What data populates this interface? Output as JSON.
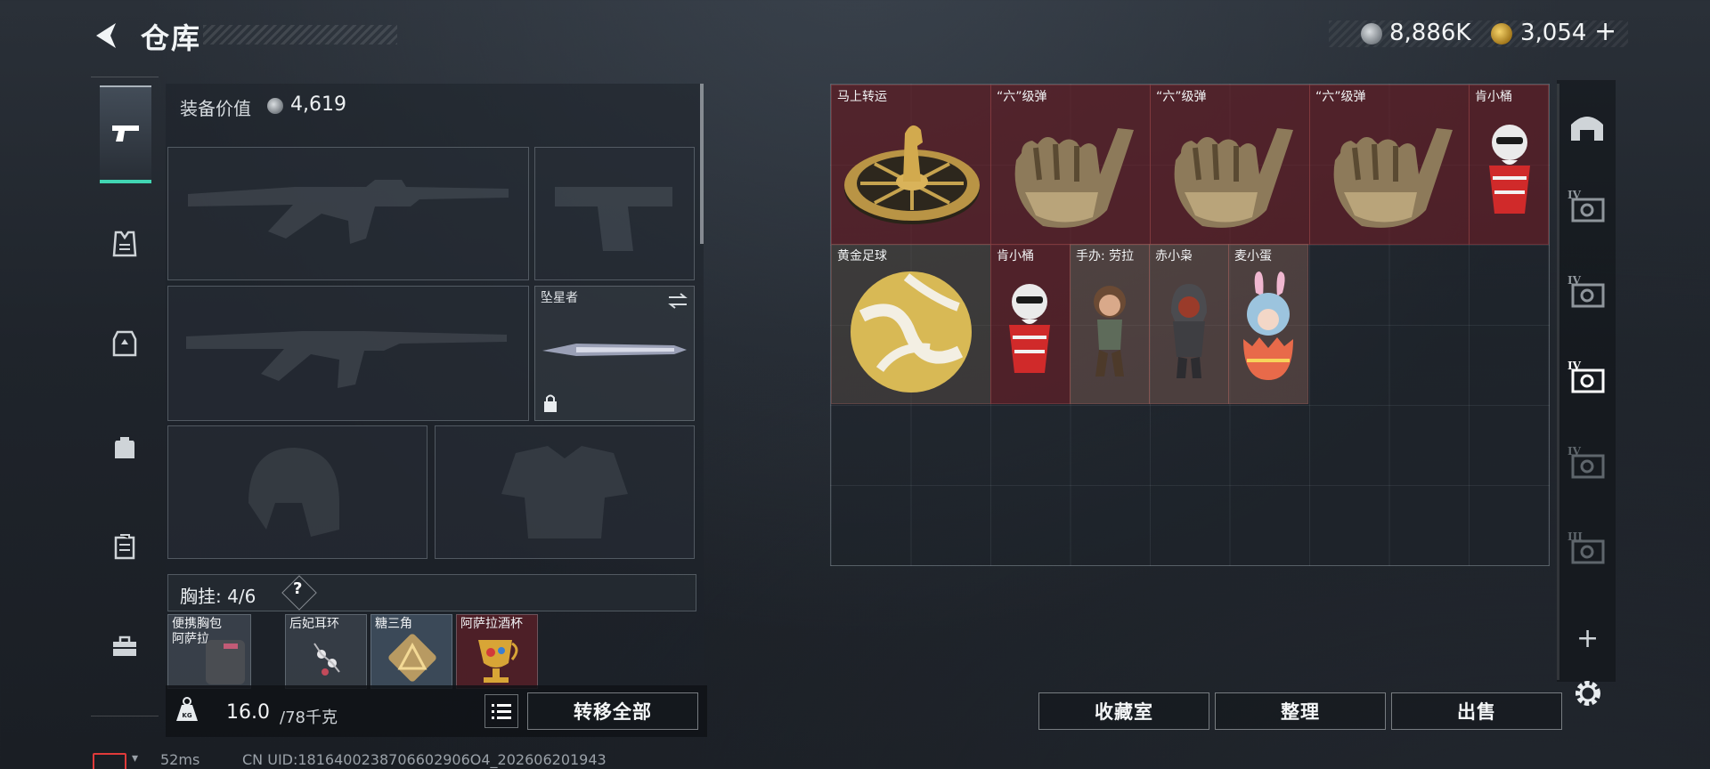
{
  "header": {
    "title": "仓库",
    "currency_silver": "8,886K",
    "currency_gold": "3,054",
    "add_label": "+"
  },
  "loadout": {
    "equip_value_label": "装备价值",
    "equip_value": "4,619",
    "melee_name": "坠星者",
    "chest_rig_label": "胸挂: ",
    "chest_rig_count": "4/6",
    "help_label": "?",
    "chest_items": [
      {
        "name": "便携胸包\n阿萨拉"
      },
      {
        "name": "后妃耳环"
      },
      {
        "name": "糖三角"
      },
      {
        "name": "阿萨拉酒杯"
      }
    ],
    "weight_current": "16.0",
    "weight_max": "/78千克",
    "transfer_all_label": "转移全部"
  },
  "storage": {
    "items": [
      {
        "name": "马上转运"
      },
      {
        "name": "“六”级弹"
      },
      {
        "name": "“六”级弹"
      },
      {
        "name": "“六”级弹"
      },
      {
        "name": "肯小桶"
      },
      {
        "name": "黄金足球"
      },
      {
        "name": "肯小桶"
      },
      {
        "name": "手办: 劳拉"
      },
      {
        "name": "赤小枭"
      },
      {
        "name": "麦小蛋"
      }
    ],
    "buttons": {
      "collection": "收藏室",
      "organize": "整理",
      "sell": "出售"
    },
    "rail_levels": [
      "IV",
      "IV",
      "IV",
      "IV",
      "III"
    ],
    "rail_add": "+"
  },
  "status": {
    "ping": "52ms",
    "uid": "CN UID:1816400238706602906O4_202606201943"
  },
  "colors": {
    "accent": "#41d6b3",
    "rarity_red": "#6e1e26",
    "battery_low": "#e03a3a"
  }
}
